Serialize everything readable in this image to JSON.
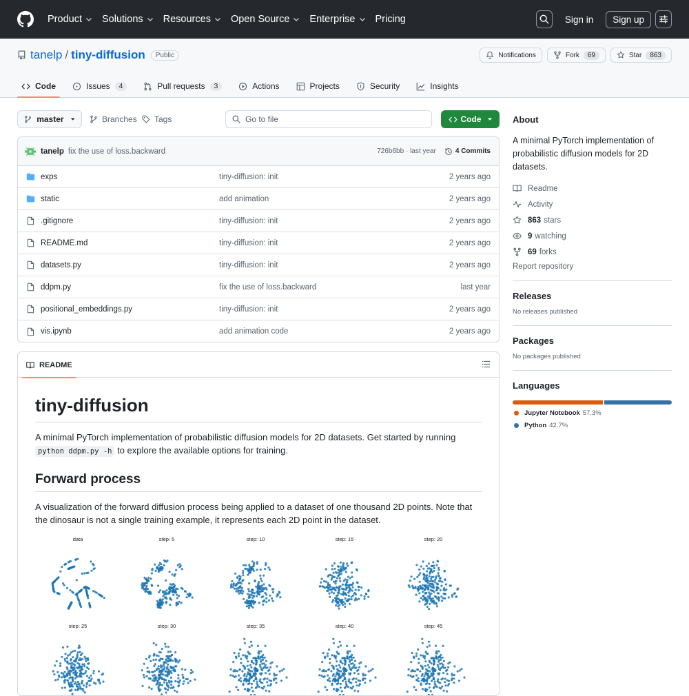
{
  "nav": {
    "items": [
      "Product",
      "Solutions",
      "Resources",
      "Open Source",
      "Enterprise",
      "Pricing"
    ],
    "dropdowns": [
      true,
      true,
      true,
      true,
      true,
      false
    ],
    "sign_in": "Sign in",
    "sign_up": "Sign up"
  },
  "repo": {
    "owner": "tanelp",
    "name": "tiny-diffusion",
    "visibility": "Public",
    "notifications_label": "Notifications",
    "fork_label": "Fork",
    "fork_count": "69",
    "star_label": "Star",
    "star_count": "863"
  },
  "tabs": [
    {
      "label": "Code",
      "count": "",
      "icon": "code-icon"
    },
    {
      "label": "Issues",
      "count": "4",
      "icon": "issue-icon"
    },
    {
      "label": "Pull requests",
      "count": "3",
      "icon": "pull-request-icon"
    },
    {
      "label": "Actions",
      "count": "",
      "icon": "play-icon"
    },
    {
      "label": "Projects",
      "count": "",
      "icon": "table-icon"
    },
    {
      "label": "Security",
      "count": "",
      "icon": "shield-icon"
    },
    {
      "label": "Insights",
      "count": "",
      "icon": "graph-icon"
    }
  ],
  "toolbar": {
    "branch": "master",
    "branches_label": "Branches",
    "tags_label": "Tags",
    "go_to_file_placeholder": "Go to file",
    "code_button": "Code"
  },
  "latest_commit": {
    "author": "tanelp",
    "message": "fix the use of loss.backward",
    "hash": "726b6bb",
    "when": "last year",
    "commits_label": "4 Commits"
  },
  "files": [
    {
      "name": "exps",
      "type": "dir",
      "message": "tiny-diffusion: init",
      "date": "2 years ago"
    },
    {
      "name": "static",
      "type": "dir",
      "message": "add animation",
      "date": "2 years ago"
    },
    {
      "name": ".gitignore",
      "type": "file",
      "message": "tiny-diffusion: init",
      "date": "2 years ago"
    },
    {
      "name": "README.md",
      "type": "file",
      "message": "tiny-diffusion: init",
      "date": "2 years ago"
    },
    {
      "name": "datasets.py",
      "type": "file",
      "message": "tiny-diffusion: init",
      "date": "2 years ago"
    },
    {
      "name": "ddpm.py",
      "type": "file",
      "message": "fix the use of loss.backward",
      "date": "last year"
    },
    {
      "name": "positional_embeddings.py",
      "type": "file",
      "message": "tiny-diffusion: init",
      "date": "2 years ago"
    },
    {
      "name": "vis.ipynb",
      "type": "file",
      "message": "add animation code",
      "date": "2 years ago"
    }
  ],
  "readme": {
    "tab_label": "README",
    "title": "tiny-diffusion",
    "intro_before": "A minimal PyTorch implementation of probabilistic diffusion models for 2D datasets. Get started by running ",
    "intro_code": "python ddpm.py -h",
    "intro_after": " to explore the available options for training.",
    "section_title": "Forward process",
    "section_text": "A visualization of the forward diffusion process being applied to a dataset of one thousand 2D points. Note that the dinosaur is not a single training example, it represents each 2D point in the dataset.",
    "plot_titles": [
      "data",
      "step: 5",
      "step: 10",
      "step: 15",
      "step: 20",
      "step: 25",
      "step: 30",
      "step: 35",
      "step: 40",
      "step: 45"
    ],
    "point_color": "#1f77b4"
  },
  "about": {
    "title": "About",
    "description": "A minimal PyTorch implementation of probabilistic diffusion models for 2D datasets.",
    "readme_label": "Readme",
    "activity_label": "Activity",
    "stars_count": "863",
    "stars_label": "stars",
    "watching_count": "9",
    "watching_label": "watching",
    "forks_count": "69",
    "forks_label": "forks",
    "report": "Report repository"
  },
  "releases": {
    "title": "Releases",
    "text": "No releases published"
  },
  "packages": {
    "title": "Packages",
    "text": "No packages published"
  },
  "languages": {
    "title": "Languages",
    "items": [
      {
        "name": "Jupyter Notebook",
        "percent": "57.3%",
        "value": 57.3,
        "color": "#DA5B0B"
      },
      {
        "name": "Python",
        "percent": "42.7%",
        "value": 42.7,
        "color": "#3572A5"
      }
    ]
  }
}
